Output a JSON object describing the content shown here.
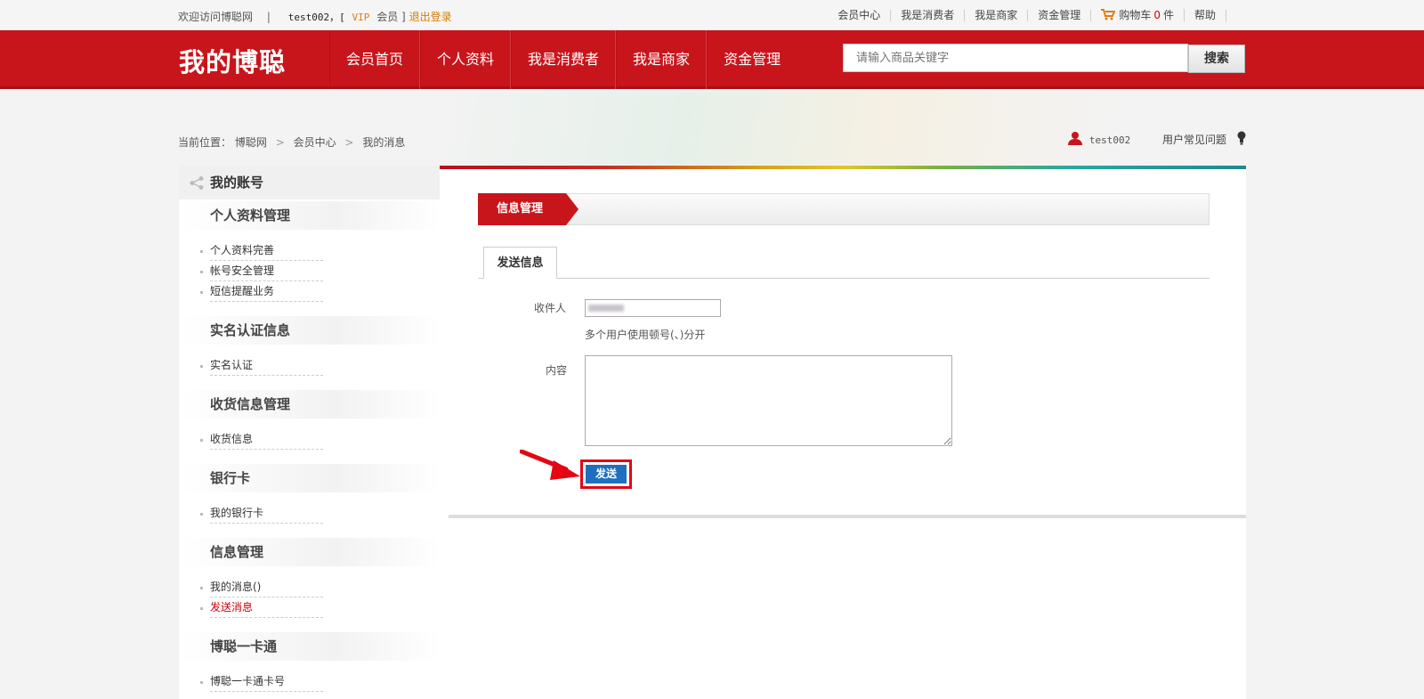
{
  "topbar": {
    "welcome": "欢迎访问博聪网",
    "separator": "|",
    "user_prefix": "test002，[",
    "vip": "VIP",
    "member": "会员 ]",
    "logout": "退出登录",
    "links": [
      "会员中心",
      "我是消费者",
      "我是商家",
      "资金管理"
    ],
    "cart_label": "购物车",
    "cart_count": "0",
    "cart_unit": "件",
    "help": "帮助"
  },
  "nav": {
    "logo": "我的博聪",
    "menu": [
      "会员首页",
      "个人资料",
      "我是消费者",
      "我是商家",
      "资金管理"
    ],
    "search_placeholder": "请输入商品关键字",
    "search_button": "搜索"
  },
  "breadcrumb": {
    "prefix": "当前位置：",
    "items": [
      "博聪网",
      "会员中心",
      "我的消息"
    ],
    "sep": ">"
  },
  "userbar": {
    "username": "test002",
    "faq": "用户常见问题"
  },
  "sidebar": {
    "title": "我的账号",
    "groups": [
      {
        "title": "个人资料管理",
        "items": [
          "个人资料完善",
          "帐号安全管理",
          "短信提醒业务"
        ]
      },
      {
        "title": "实名认证信息",
        "items": [
          "实名认证"
        ]
      },
      {
        "title": "收货信息管理",
        "items": [
          "收货信息"
        ]
      },
      {
        "title": "银行卡",
        "items": [
          "我的银行卡"
        ]
      },
      {
        "title": "信息管理",
        "items": [
          "我的消息()",
          "发送消息"
        ]
      },
      {
        "title": "博聪一卡通",
        "items": [
          "博聪一卡通卡号"
        ]
      }
    ]
  },
  "main": {
    "section_title": "信息管理",
    "tab": "发送信息",
    "recipient_label": "收件人",
    "recipient_hint": "多个用户使用顿号(、)分开",
    "content_label": "内容",
    "send_button": "发送"
  },
  "colors": {
    "brand_red": "#c8151c",
    "send_blue": "#1f6fc0",
    "highlight_red": "#e30613",
    "link_orange": "#d97a00"
  }
}
